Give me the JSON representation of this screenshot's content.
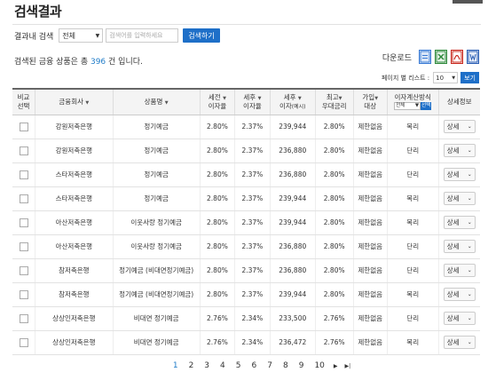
{
  "page": {
    "title": "검색결과"
  },
  "search": {
    "label": "결과내 검색",
    "scope_value": "전체",
    "placeholder": "검색어를 입력하세요",
    "button_label": "검색하기"
  },
  "summary": {
    "prefix": "검색된 금융 상품은 총 ",
    "count": "396",
    "suffix": " 건 입니다."
  },
  "download": {
    "label": "다운로드",
    "icons": [
      "hwp-icon",
      "excel-icon",
      "pdf-icon",
      "word-icon"
    ]
  },
  "per_page": {
    "label": "페이지 별 리스트 :",
    "value": "10",
    "button_label": "보기"
  },
  "table": {
    "headers": {
      "compare": [
        "비교",
        "선택"
      ],
      "company": "금융회사",
      "product": "상품명",
      "pre_tax": [
        "세전",
        "이자율"
      ],
      "post_tax": [
        "세후",
        "이자율"
      ],
      "post_tax_interest": [
        "세후",
        "이자",
        "(예시)"
      ],
      "max_rate": [
        "최고",
        "우대금리"
      ],
      "join": [
        "가입",
        "대상"
      ],
      "calc": "이자계산방식",
      "calc_select": "전체",
      "calc_button": "선택",
      "detail": "상세정보"
    },
    "detail_label": "상세",
    "rows": [
      {
        "company": "강원저축은행",
        "product": "정기예금",
        "pre_tax": "2.80%",
        "post_tax": "2.37%",
        "interest": "239,944",
        "max_rate": "2.80%",
        "join": "제한없음",
        "calc": "복리"
      },
      {
        "company": "강원저축은행",
        "product": "정기예금",
        "pre_tax": "2.80%",
        "post_tax": "2.37%",
        "interest": "236,880",
        "max_rate": "2.80%",
        "join": "제한없음",
        "calc": "단리"
      },
      {
        "company": "스타저축은행",
        "product": "정기예금",
        "pre_tax": "2.80%",
        "post_tax": "2.37%",
        "interest": "236,880",
        "max_rate": "2.80%",
        "join": "제한없음",
        "calc": "단리"
      },
      {
        "company": "스타저축은행",
        "product": "정기예금",
        "pre_tax": "2.80%",
        "post_tax": "2.37%",
        "interest": "239,944",
        "max_rate": "2.80%",
        "join": "제한없음",
        "calc": "복리"
      },
      {
        "company": "아산저축은행",
        "product": "이웃사랑 정기예금",
        "pre_tax": "2.80%",
        "post_tax": "2.37%",
        "interest": "239,944",
        "max_rate": "2.80%",
        "join": "제한없음",
        "calc": "복리"
      },
      {
        "company": "아산저축은행",
        "product": "이웃사랑 정기예금",
        "pre_tax": "2.80%",
        "post_tax": "2.37%",
        "interest": "236,880",
        "max_rate": "2.80%",
        "join": "제한없음",
        "calc": "단리"
      },
      {
        "company": "참저축은행",
        "product": "정기예금 (비대면정기예금)",
        "pre_tax": "2.80%",
        "post_tax": "2.37%",
        "interest": "236,880",
        "max_rate": "2.80%",
        "join": "제한없음",
        "calc": "단리"
      },
      {
        "company": "참저축은행",
        "product": "정기예금 (비대면정기예금)",
        "pre_tax": "2.80%",
        "post_tax": "2.37%",
        "interest": "239,944",
        "max_rate": "2.80%",
        "join": "제한없음",
        "calc": "복리"
      },
      {
        "company": "상상인저축은행",
        "product": "비대면 정기예금",
        "pre_tax": "2.76%",
        "post_tax": "2.34%",
        "interest": "233,500",
        "max_rate": "2.76%",
        "join": "제한없음",
        "calc": "단리"
      },
      {
        "company": "상상인저축은행",
        "product": "비대면 정기예금",
        "pre_tax": "2.76%",
        "post_tax": "2.34%",
        "interest": "236,472",
        "max_rate": "2.76%",
        "join": "제한없음",
        "calc": "복리"
      }
    ]
  },
  "pagination": {
    "pages": [
      "1",
      "2",
      "3",
      "4",
      "5",
      "6",
      "7",
      "8",
      "9",
      "10"
    ],
    "current": "1",
    "next_symbol": "▶",
    "last_symbol": "▶|"
  },
  "colors": {
    "accent": "#1e6fc8",
    "link": "#1e7bc8"
  }
}
